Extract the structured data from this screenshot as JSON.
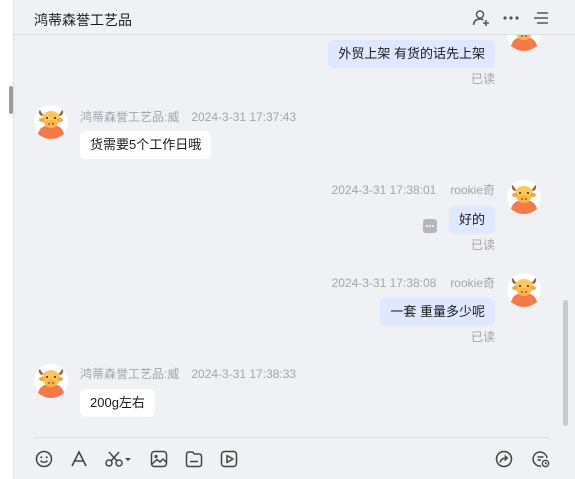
{
  "header": {
    "title": "鸿蒂森誉工艺品"
  },
  "messages": [
    {
      "side": "right",
      "text": "外贸上架  有货的话先上架",
      "read": "已读"
    },
    {
      "side": "left",
      "sender": "鸿蒂森誉工艺品:威",
      "time": "2024-3-31 17:37:43",
      "text": "货需要5个工作日哦"
    },
    {
      "side": "right",
      "sender": "rookie奇",
      "time": "2024-3-31 17:38:01",
      "text": "好的",
      "read": "已读"
    },
    {
      "side": "right",
      "sender": "rookie奇",
      "time": "2024-3-31 17:38:08",
      "text": "一套 重量多少呢",
      "read": "已读"
    },
    {
      "side": "left",
      "sender": "鸿蒂森誉工艺品:威",
      "time": "2024-3-31 17:38:33",
      "text": "200g左右"
    }
  ],
  "colors": {
    "background": "#f0f1f5",
    "bubble_self": "#dfe8ff",
    "bubble_other": "#ffffff",
    "avatar_orange": "#f27a4b",
    "avatar_face": "#ffc65a"
  },
  "icons": {
    "header": [
      "add-user-icon",
      "more-icon",
      "menu-list-icon"
    ],
    "toolbar_left": [
      "emoji-icon",
      "font-icon",
      "scissors-icon",
      "image-icon",
      "folder-icon",
      "video-icon"
    ],
    "toolbar_right": [
      "forward-icon",
      "history-icon"
    ]
  }
}
